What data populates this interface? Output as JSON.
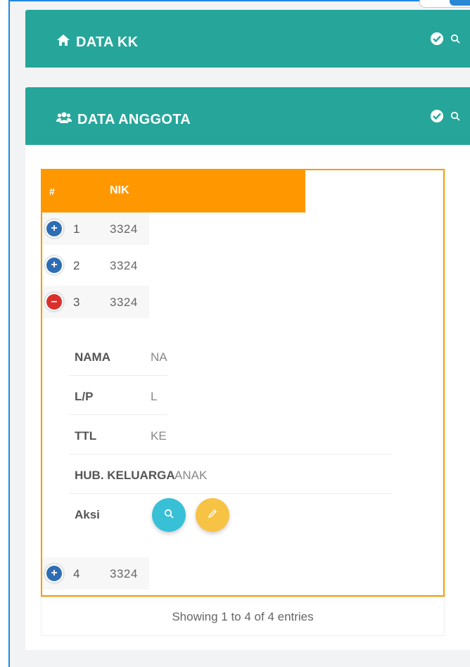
{
  "panels": {
    "kk": {
      "title": "DATA KK",
      "icon": "home-icon",
      "color": "#26a69a"
    },
    "anggota": {
      "title": "DATA ANGGOTA",
      "icon": "users-icon",
      "color": "#26a69a"
    }
  },
  "table": {
    "header": {
      "hash": "#",
      "nik": "NIK",
      "color": "#ff9800"
    },
    "rows": [
      {
        "num": "1",
        "nik": "3324",
        "expanded": false
      },
      {
        "num": "2",
        "nik": "3324",
        "expanded": false
      },
      {
        "num": "3",
        "nik": "3324",
        "expanded": true
      },
      {
        "num": "4",
        "nik": "3324",
        "expanded": false
      }
    ],
    "detail": {
      "nama_label": "NAMA",
      "nama_value": "NA",
      "lp_label": "L/P",
      "lp_value": "L",
      "ttl_label": "TTL",
      "ttl_value": "KE",
      "hub_label": "HUB. KELUARGA",
      "hub_value": "ANAK",
      "aksi_label": "Aksi"
    },
    "footer": "Showing 1 to 4 of 4 entries"
  },
  "colors": {
    "view_button": "#38c0d6",
    "edit_button": "#f6c344",
    "expand": "#2e6db4",
    "collapse": "#d9302c"
  }
}
